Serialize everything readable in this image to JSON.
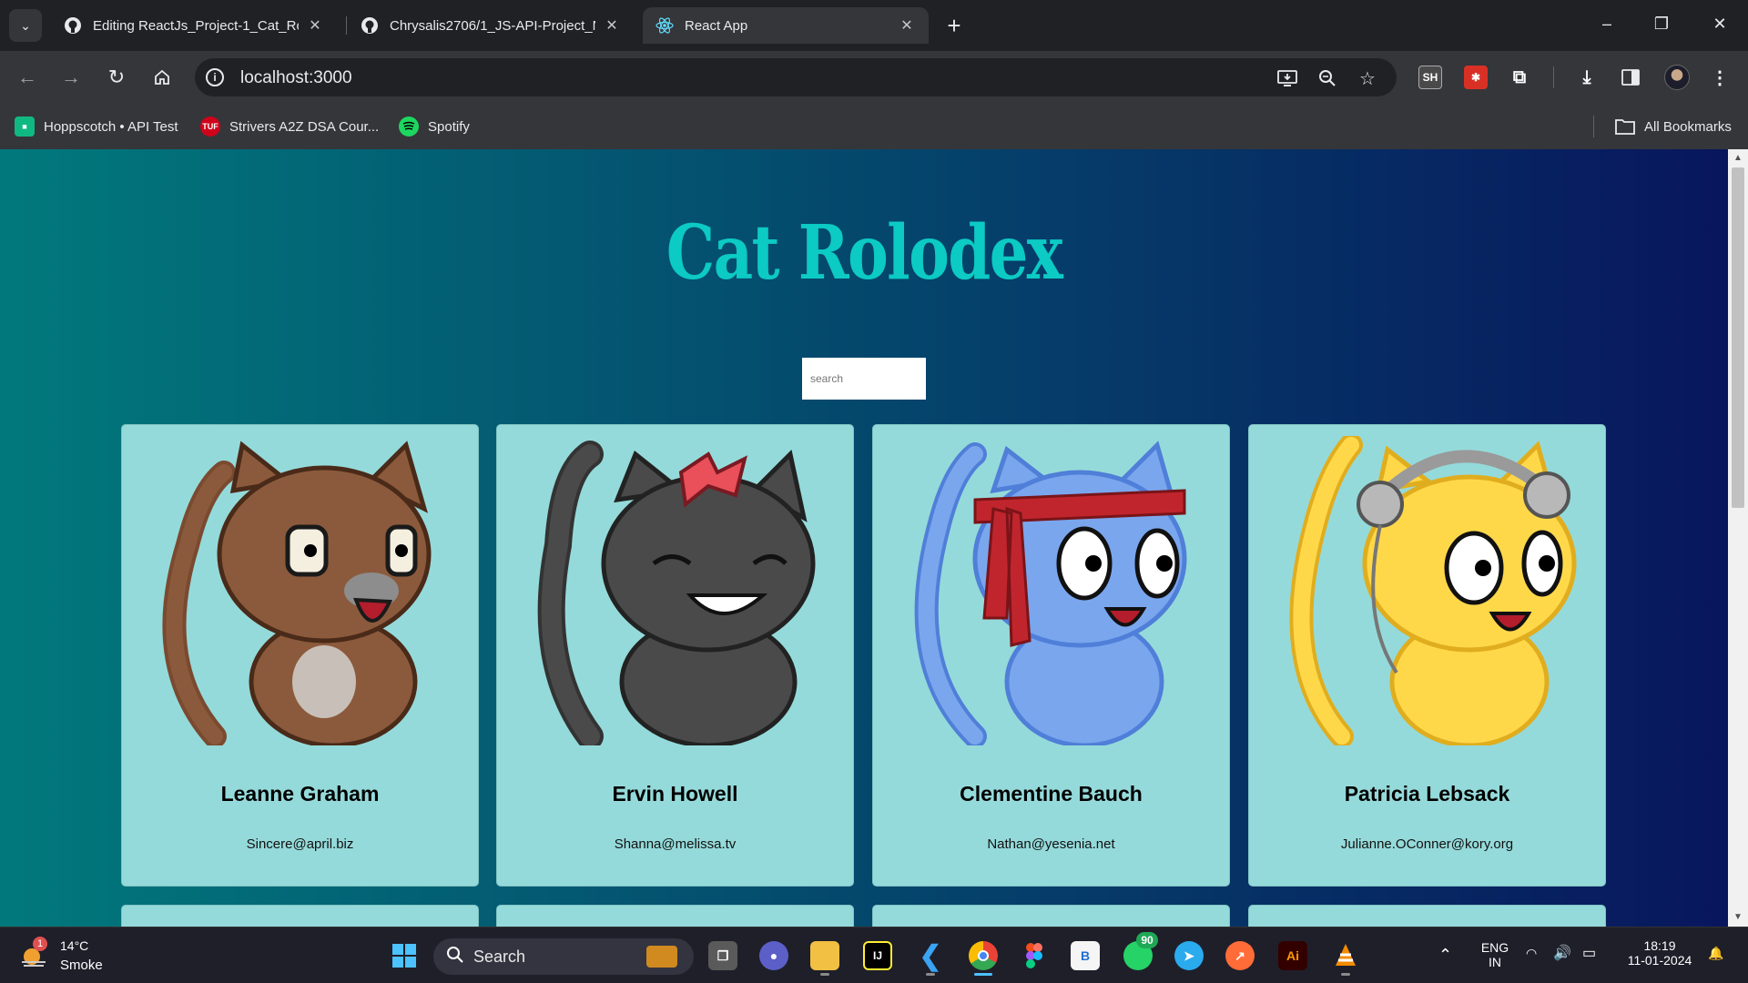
{
  "browser": {
    "tabs": [
      {
        "title": "Editing ReactJs_Project-1_Cat_Rolo",
        "icon": "github-icon",
        "active": false
      },
      {
        "title": "Chrysalis2706/1_JS-API-Project_Ne",
        "icon": "github-icon",
        "active": false
      },
      {
        "title": "React App",
        "icon": "react-icon",
        "active": true
      }
    ],
    "new_tab_label": "+",
    "url": "localhost:3000",
    "bookmarks": [
      {
        "label": "Hoppscotch • API Test",
        "icon": "hoppscotch-icon"
      },
      {
        "label": "Strivers A2Z DSA Cour...",
        "icon": "tuf-icon",
        "icon_text": "TUF"
      },
      {
        "label": "Spotify",
        "icon": "spotify-icon"
      }
    ],
    "all_bookmarks_label": "All Bookmarks",
    "extension_sh_label": "SH"
  },
  "app": {
    "title": "Cat Rolodex",
    "search_placeholder": "search",
    "cats": [
      {
        "name": "Leanne Graham",
        "email": "Sincere@april.biz",
        "color": "#8b5a3c"
      },
      {
        "name": "Ervin Howell",
        "email": "Shanna@melissa.tv",
        "color": "#4a4a4a"
      },
      {
        "name": "Clementine Bauch",
        "email": "Nathan@yesenia.net",
        "color": "#7aa6ee"
      },
      {
        "name": "Patricia Lebsack",
        "email": "Julianne.OConner@kory.org",
        "color": "#ffd84a"
      }
    ]
  },
  "taskbar": {
    "weather_badge": "1",
    "temperature": "14°C",
    "condition": "Smoke",
    "search_label": "Search",
    "whatsapp_badge": "90",
    "language_line1": "ENG",
    "language_line2": "IN",
    "time": "18:19",
    "date": "11-01-2024"
  },
  "colors": {
    "title_teal": "#0ccac4",
    "card_bg": "#95dada",
    "gradient_left": "#007e7d",
    "gradient_right": "#08165d"
  }
}
